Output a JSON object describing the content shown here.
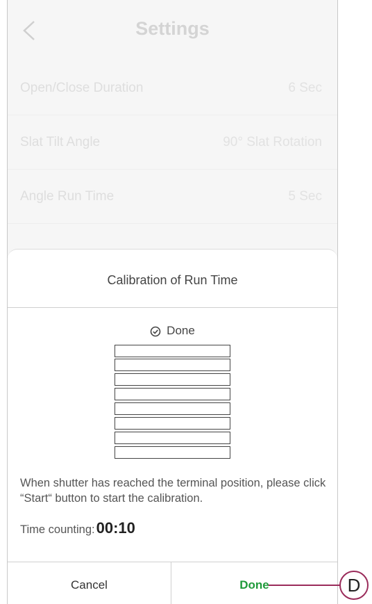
{
  "header": {
    "title": "Settings"
  },
  "settings": {
    "rows": [
      {
        "label": "Open/Close Duration",
        "value": "6 Sec"
      },
      {
        "label": "Slat Tilt Angle",
        "value": "90° Slat Rotation"
      },
      {
        "label": "Angle Run Time",
        "value": "5 Sec"
      }
    ]
  },
  "modal": {
    "title": "Calibration of Run Time",
    "status": "Done",
    "instruction": "When shutter has reached the terminal position, please click “Start“ button to start the calibration.",
    "time_label": "Time counting:",
    "time_value": "00:10",
    "cancel_label": "Cancel",
    "done_label": "Done"
  },
  "callout": {
    "label": "D"
  },
  "colors": {
    "done_green": "#1f9a3a",
    "callout": "#9a2b5a"
  },
  "icons": {
    "back": "chevron-left-icon",
    "status": "check-circle-icon",
    "shutter": "shutter-icon"
  }
}
